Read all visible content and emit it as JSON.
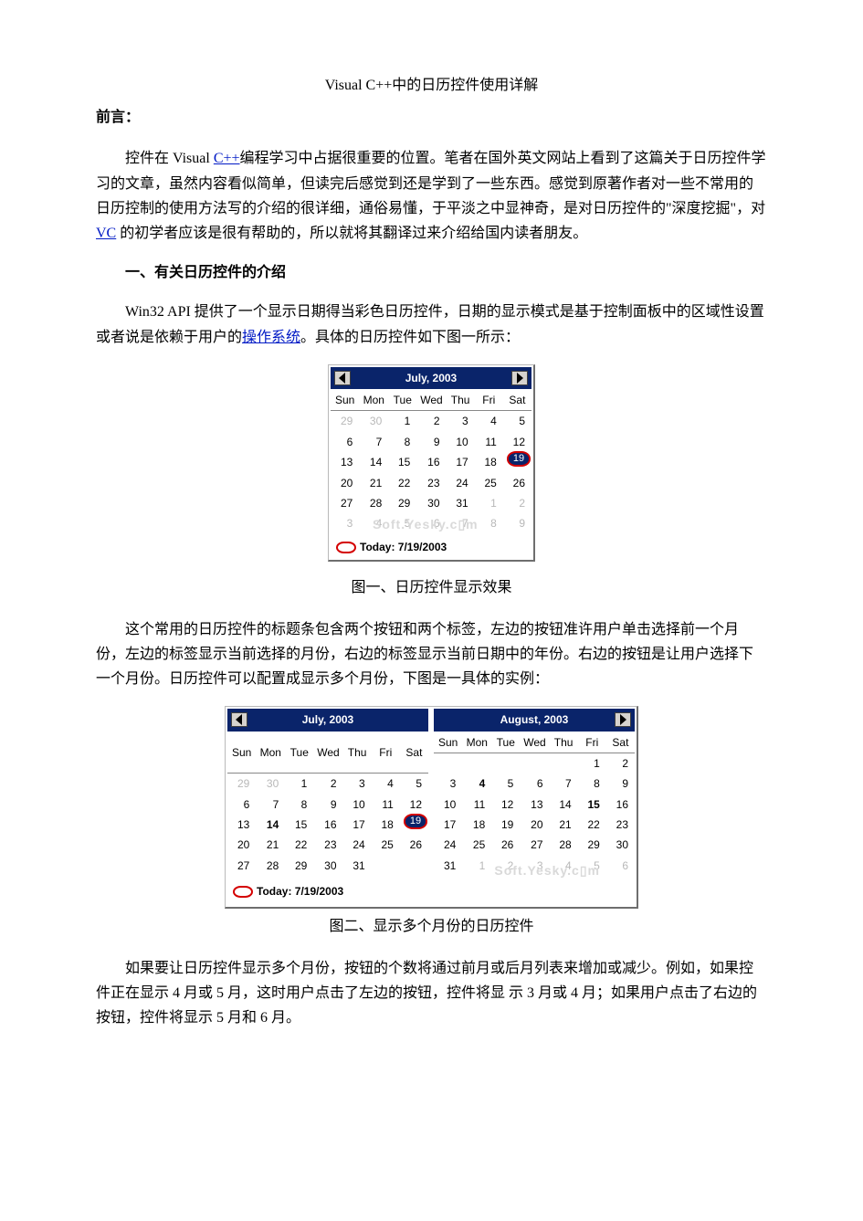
{
  "title": "Visual C++中的日历控件使用详解",
  "preface_label": "前言：",
  "para1_a": "控件在 Visual ",
  "link1": "C++",
  "para1_b": "编程学习中占据很重要的位置。笔者在国外英文网站上看到了这篇关于日历控件学习的文章，虽然内容看似简单，但读完后感觉到还是学到了一些东西。感觉到原著作者对一些不常用的日历控制的使用方法写的介绍的很详细，通俗易懂，于平淡之中显神奇，是对日历控件的\"深度挖掘\"，对 ",
  "link2": "VC",
  "para1_c": " 的初学者应该是很有帮助的，所以就将其翻译过来介绍给国内读者朋友。",
  "section1": "一、有关日历控件的介绍",
  "para2_a": "Win32 API 提供了一个显示日期得当彩色日历控件，日期的显示模式是基于控制面板中的区域性设置或者说是依赖于用户的",
  "link3": "操作系统",
  "para2_b": "。具体的日历控件如下图一所示：",
  "fig1_caption": "图一、日历控件显示效果",
  "para3": "这个常用的日历控件的标题条包含两个按钮和两个标签，左边的按钮准许用户单击选择前一个月份，左边的标签显示当前选择的月份，右边的标签显示当前日期中的年份。右边的按钮是让用户选择下一个月份。日历控件可以配置成显示多个月份，下图是一具体的实例：",
  "fig2_caption": "图二、显示多个月份的日历控件",
  "para4": "如果要让日历控件显示多个月份，按钮的个数将通过前月或后月列表来增加或减少。例如，如果控件正在显示 4 月或 5 月，这时用户点击了左边的按钮，控件将显 示 3 月或 4 月；如果用户点击了右边的按钮，控件将显示 5 月和 6 月。",
  "calendar": {
    "day_headers": [
      "Sun",
      "Mon",
      "Tue",
      "Wed",
      "Thu",
      "Fri",
      "Sat"
    ],
    "today_label": "Today: 7/19/2003",
    "watermark": "Soft.Yesky.c▯m"
  },
  "cal_july": {
    "title": "July, 2003",
    "rows": [
      [
        {
          "v": "29",
          "dim": true
        },
        {
          "v": "30",
          "dim": true
        },
        {
          "v": "1"
        },
        {
          "v": "2"
        },
        {
          "v": "3"
        },
        {
          "v": "4"
        },
        {
          "v": "5"
        }
      ],
      [
        {
          "v": "6"
        },
        {
          "v": "7"
        },
        {
          "v": "8"
        },
        {
          "v": "9"
        },
        {
          "v": "10"
        },
        {
          "v": "11"
        },
        {
          "v": "12"
        }
      ],
      [
        {
          "v": "13"
        },
        {
          "v": "14"
        },
        {
          "v": "15"
        },
        {
          "v": "16"
        },
        {
          "v": "17"
        },
        {
          "v": "18"
        },
        {
          "v": "19",
          "today": true
        }
      ],
      [
        {
          "v": "20"
        },
        {
          "v": "21"
        },
        {
          "v": "22"
        },
        {
          "v": "23"
        },
        {
          "v": "24"
        },
        {
          "v": "25"
        },
        {
          "v": "26"
        }
      ],
      [
        {
          "v": "27"
        },
        {
          "v": "28"
        },
        {
          "v": "29"
        },
        {
          "v": "30"
        },
        {
          "v": "31"
        },
        {
          "v": "1",
          "dim": true
        },
        {
          "v": "2",
          "dim": true
        }
      ],
      [
        {
          "v": "3",
          "dim": true
        },
        {
          "v": "4",
          "dim": true
        },
        {
          "v": "5",
          "dim": true
        },
        {
          "v": "6",
          "dim": true
        },
        {
          "v": "7",
          "dim": true
        },
        {
          "v": "8",
          "dim": true
        },
        {
          "v": "9",
          "dim": true
        }
      ]
    ]
  },
  "cal_july_b": {
    "title": "July, 2003",
    "rows": [
      [
        {
          "v": "29",
          "dim": true
        },
        {
          "v": "30",
          "dim": true
        },
        {
          "v": "1"
        },
        {
          "v": "2"
        },
        {
          "v": "3"
        },
        {
          "v": "4"
        },
        {
          "v": "5"
        }
      ],
      [
        {
          "v": "6"
        },
        {
          "v": "7"
        },
        {
          "v": "8"
        },
        {
          "v": "9"
        },
        {
          "v": "10"
        },
        {
          "v": "11"
        },
        {
          "v": "12"
        }
      ],
      [
        {
          "v": "13"
        },
        {
          "v": "14",
          "bold": true
        },
        {
          "v": "15"
        },
        {
          "v": "16"
        },
        {
          "v": "17"
        },
        {
          "v": "18"
        },
        {
          "v": "19",
          "today": true
        }
      ],
      [
        {
          "v": "20"
        },
        {
          "v": "21"
        },
        {
          "v": "22"
        },
        {
          "v": "23"
        },
        {
          "v": "24"
        },
        {
          "v": "25"
        },
        {
          "v": "26"
        }
      ],
      [
        {
          "v": "27"
        },
        {
          "v": "28"
        },
        {
          "v": "29"
        },
        {
          "v": "30"
        },
        {
          "v": "31"
        },
        {
          "v": ""
        },
        {
          "v": ""
        }
      ]
    ]
  },
  "cal_aug": {
    "title": "August, 2003",
    "rows": [
      [
        {
          "v": ""
        },
        {
          "v": ""
        },
        {
          "v": ""
        },
        {
          "v": ""
        },
        {
          "v": ""
        },
        {
          "v": "1"
        },
        {
          "v": "2"
        }
      ],
      [
        {
          "v": "3"
        },
        {
          "v": "4",
          "bold": true
        },
        {
          "v": "5"
        },
        {
          "v": "6"
        },
        {
          "v": "7"
        },
        {
          "v": "8"
        },
        {
          "v": "9"
        }
      ],
      [
        {
          "v": "10"
        },
        {
          "v": "11"
        },
        {
          "v": "12"
        },
        {
          "v": "13"
        },
        {
          "v": "14"
        },
        {
          "v": "15",
          "bold": true
        },
        {
          "v": "16"
        }
      ],
      [
        {
          "v": "17"
        },
        {
          "v": "18"
        },
        {
          "v": "19"
        },
        {
          "v": "20"
        },
        {
          "v": "21"
        },
        {
          "v": "22"
        },
        {
          "v": "23"
        }
      ],
      [
        {
          "v": "24"
        },
        {
          "v": "25"
        },
        {
          "v": "26"
        },
        {
          "v": "27"
        },
        {
          "v": "28"
        },
        {
          "v": "29"
        },
        {
          "v": "30"
        }
      ],
      [
        {
          "v": "31"
        },
        {
          "v": "1",
          "dim": true
        },
        {
          "v": "2",
          "dim": true
        },
        {
          "v": "3",
          "dim": true
        },
        {
          "v": "4",
          "dim": true
        },
        {
          "v": "5",
          "dim": true
        },
        {
          "v": "6",
          "dim": true
        }
      ]
    ]
  }
}
